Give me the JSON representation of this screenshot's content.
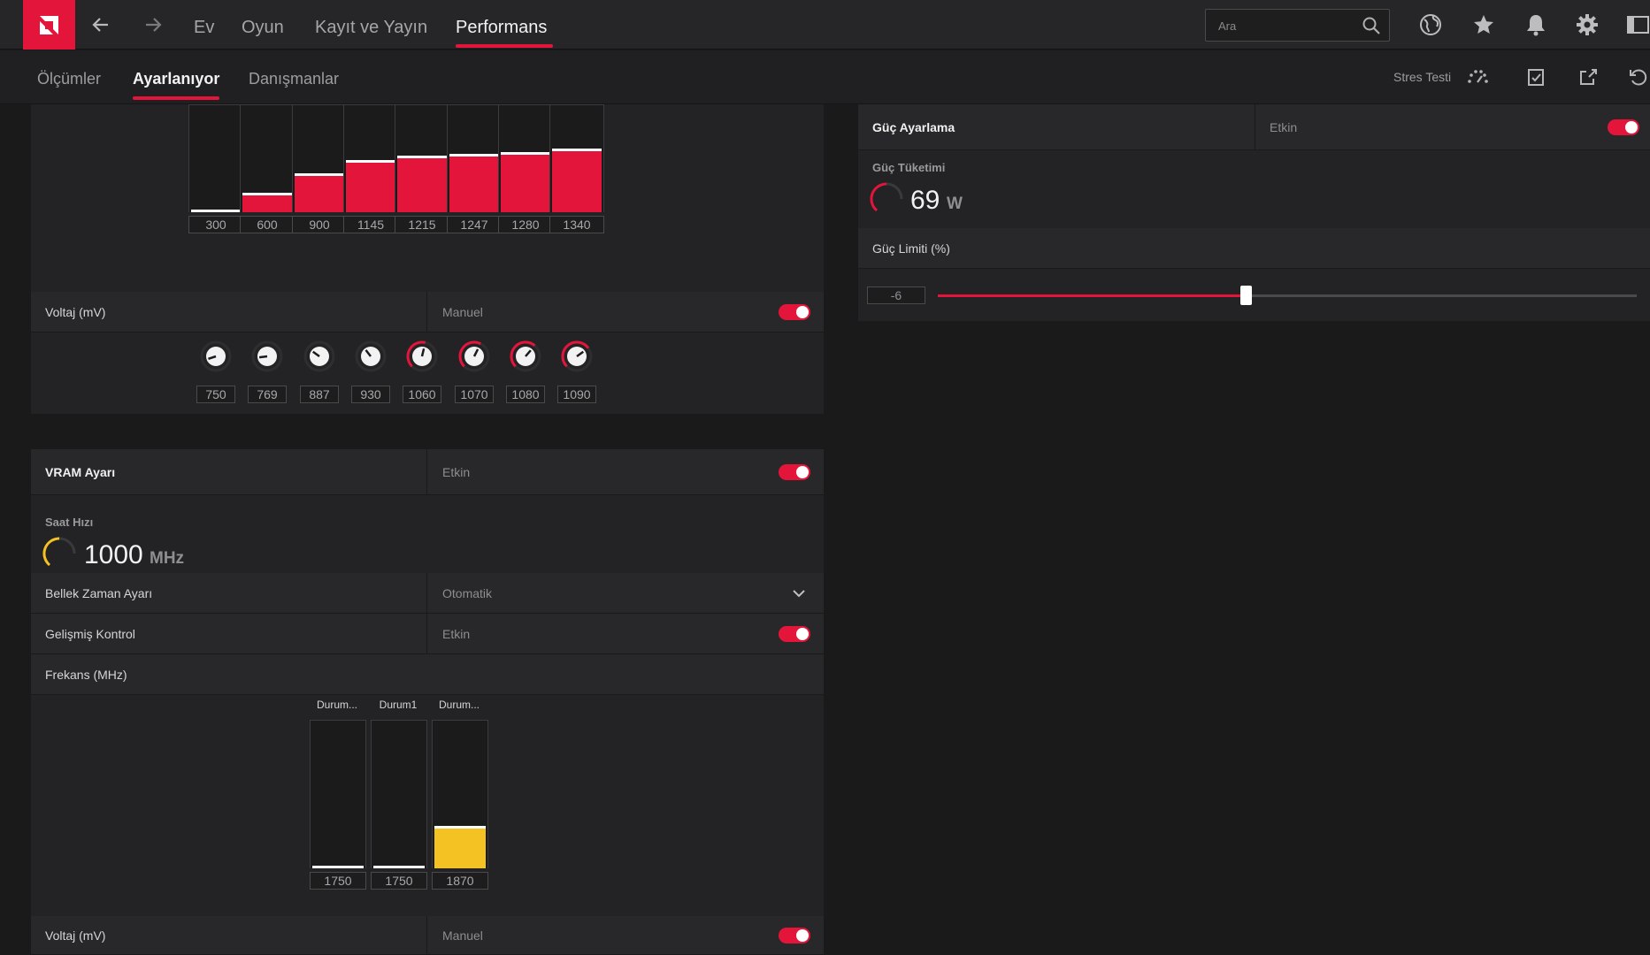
{
  "colors": {
    "accent": "#e4153b",
    "yellow": "#f4c223"
  },
  "nav": {
    "back_icon": "arrow-left-icon",
    "forward_icon": "arrow-right-icon",
    "items": [
      {
        "label": "Ev"
      },
      {
        "label": "Oyun"
      },
      {
        "label": "Kayıt ve Yayın"
      },
      {
        "label": "Performans"
      }
    ],
    "active": "Performans"
  },
  "search": {
    "placeholder": "Ara",
    "icon": "search-icon"
  },
  "toolbar": {
    "icons": [
      "globe-icon",
      "star-icon",
      "bell-icon",
      "gear-icon",
      "sidebar-toggle-icon"
    ]
  },
  "subnav": {
    "tabs": [
      {
        "label": "Ölçümler"
      },
      {
        "label": "Ayarlanıyor"
      },
      {
        "label": "Danışmanlar"
      }
    ],
    "active": "Ayarlanıyor",
    "stress_test": "Stres Testi",
    "icons": [
      "gauge-icon",
      "checklist-icon",
      "export-icon",
      "reset-icon"
    ]
  },
  "gpu_freq": {
    "values": [
      "300",
      "600",
      "900",
      "1145",
      "1215",
      "1247",
      "1280",
      "1340"
    ],
    "fill_percent": [
      0,
      19,
      37,
      50,
      54,
      56,
      58,
      61
    ]
  },
  "gpu_voltage": {
    "label": "Voltaj (mV)",
    "mode": "Manuel",
    "enabled": true,
    "values": [
      "750",
      "769",
      "887",
      "930",
      "1060",
      "1070",
      "1080",
      "1090"
    ],
    "knob_percent": [
      10,
      14,
      30,
      36,
      55,
      60,
      65,
      70
    ]
  },
  "vram": {
    "title": "VRAM Ayarı",
    "status": "Etkin",
    "enabled": true,
    "clock_label": "Saat Hızı",
    "clock_value": "1000",
    "clock_unit": "MHz",
    "timing_label": "Bellek Zaman Ayarı",
    "timing_value": "Otomatik",
    "advanced_label": "Gelişmiş Kontrol",
    "advanced_status": "Etkin",
    "advanced_enabled": true,
    "freq_label": "Frekans (MHz)",
    "states": [
      {
        "name": "Durum...",
        "value": "1750",
        "fill_percent": 0
      },
      {
        "name": "Durum1",
        "value": "1750",
        "fill_percent": 0
      },
      {
        "name": "Durum...",
        "value": "1870",
        "fill_percent": 29
      }
    ],
    "voltage_label": "Voltaj (mV)",
    "voltage_mode": "Manuel",
    "voltage_enabled": true
  },
  "power": {
    "title": "Güç Ayarlama",
    "status": "Etkin",
    "enabled": true,
    "consumption_label": "Güç Tüketimi",
    "consumption_value": "69",
    "consumption_unit": "W",
    "limit_label": "Güç Limiti (%)",
    "limit_value": "-6",
    "limit_percent": 44
  }
}
